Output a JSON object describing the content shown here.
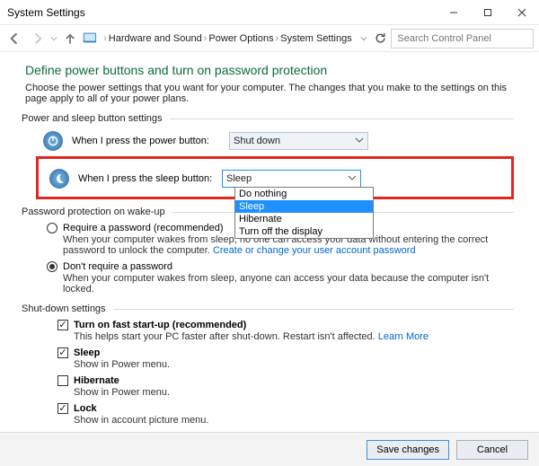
{
  "title": "System Settings",
  "search_placeholder": "Search Control Panel",
  "breadcrumbs": [
    "Hardware and Sound",
    "Power Options",
    "System Settings"
  ],
  "heading": "Define power buttons and turn on password protection",
  "intro": "Choose the power settings that you want for your computer. The changes that you make to the settings on this page apply to all of your power plans.",
  "groups": {
    "buttons": "Power and sleep button settings",
    "password": "Password protection on wake-up",
    "shutdown": "Shut-down settings"
  },
  "power_btn": {
    "label": "When I press the power button:",
    "value": "Shut down"
  },
  "sleep_btn": {
    "label": "When I press the sleep button:",
    "value": "Sleep",
    "options": [
      "Do nothing",
      "Sleep",
      "Hibernate",
      "Turn off the display"
    ]
  },
  "pw_req": {
    "label": "Require a password (recommended)",
    "desc_a": "When your computer wakes from sleep, no one can access your data without entering the correct password to unlock the computer. ",
    "link": "Create or change your user account password"
  },
  "pw_none": {
    "label": "Don't require a password",
    "desc": "When your computer wakes from sleep, anyone can access your data because the computer isn't locked."
  },
  "shutdown": {
    "fast": {
      "label": "Turn on fast start-up (recommended)",
      "desc": "This helps start your PC faster after shut-down. Restart isn't affected. ",
      "link": "Learn More"
    },
    "sleep": {
      "label": "Sleep",
      "desc": "Show in Power menu."
    },
    "hibernate": {
      "label": "Hibernate",
      "desc": "Show in Power menu."
    },
    "lock": {
      "label": "Lock",
      "desc": "Show in account picture menu."
    }
  },
  "footer": {
    "save": "Save changes",
    "cancel": "Cancel"
  }
}
